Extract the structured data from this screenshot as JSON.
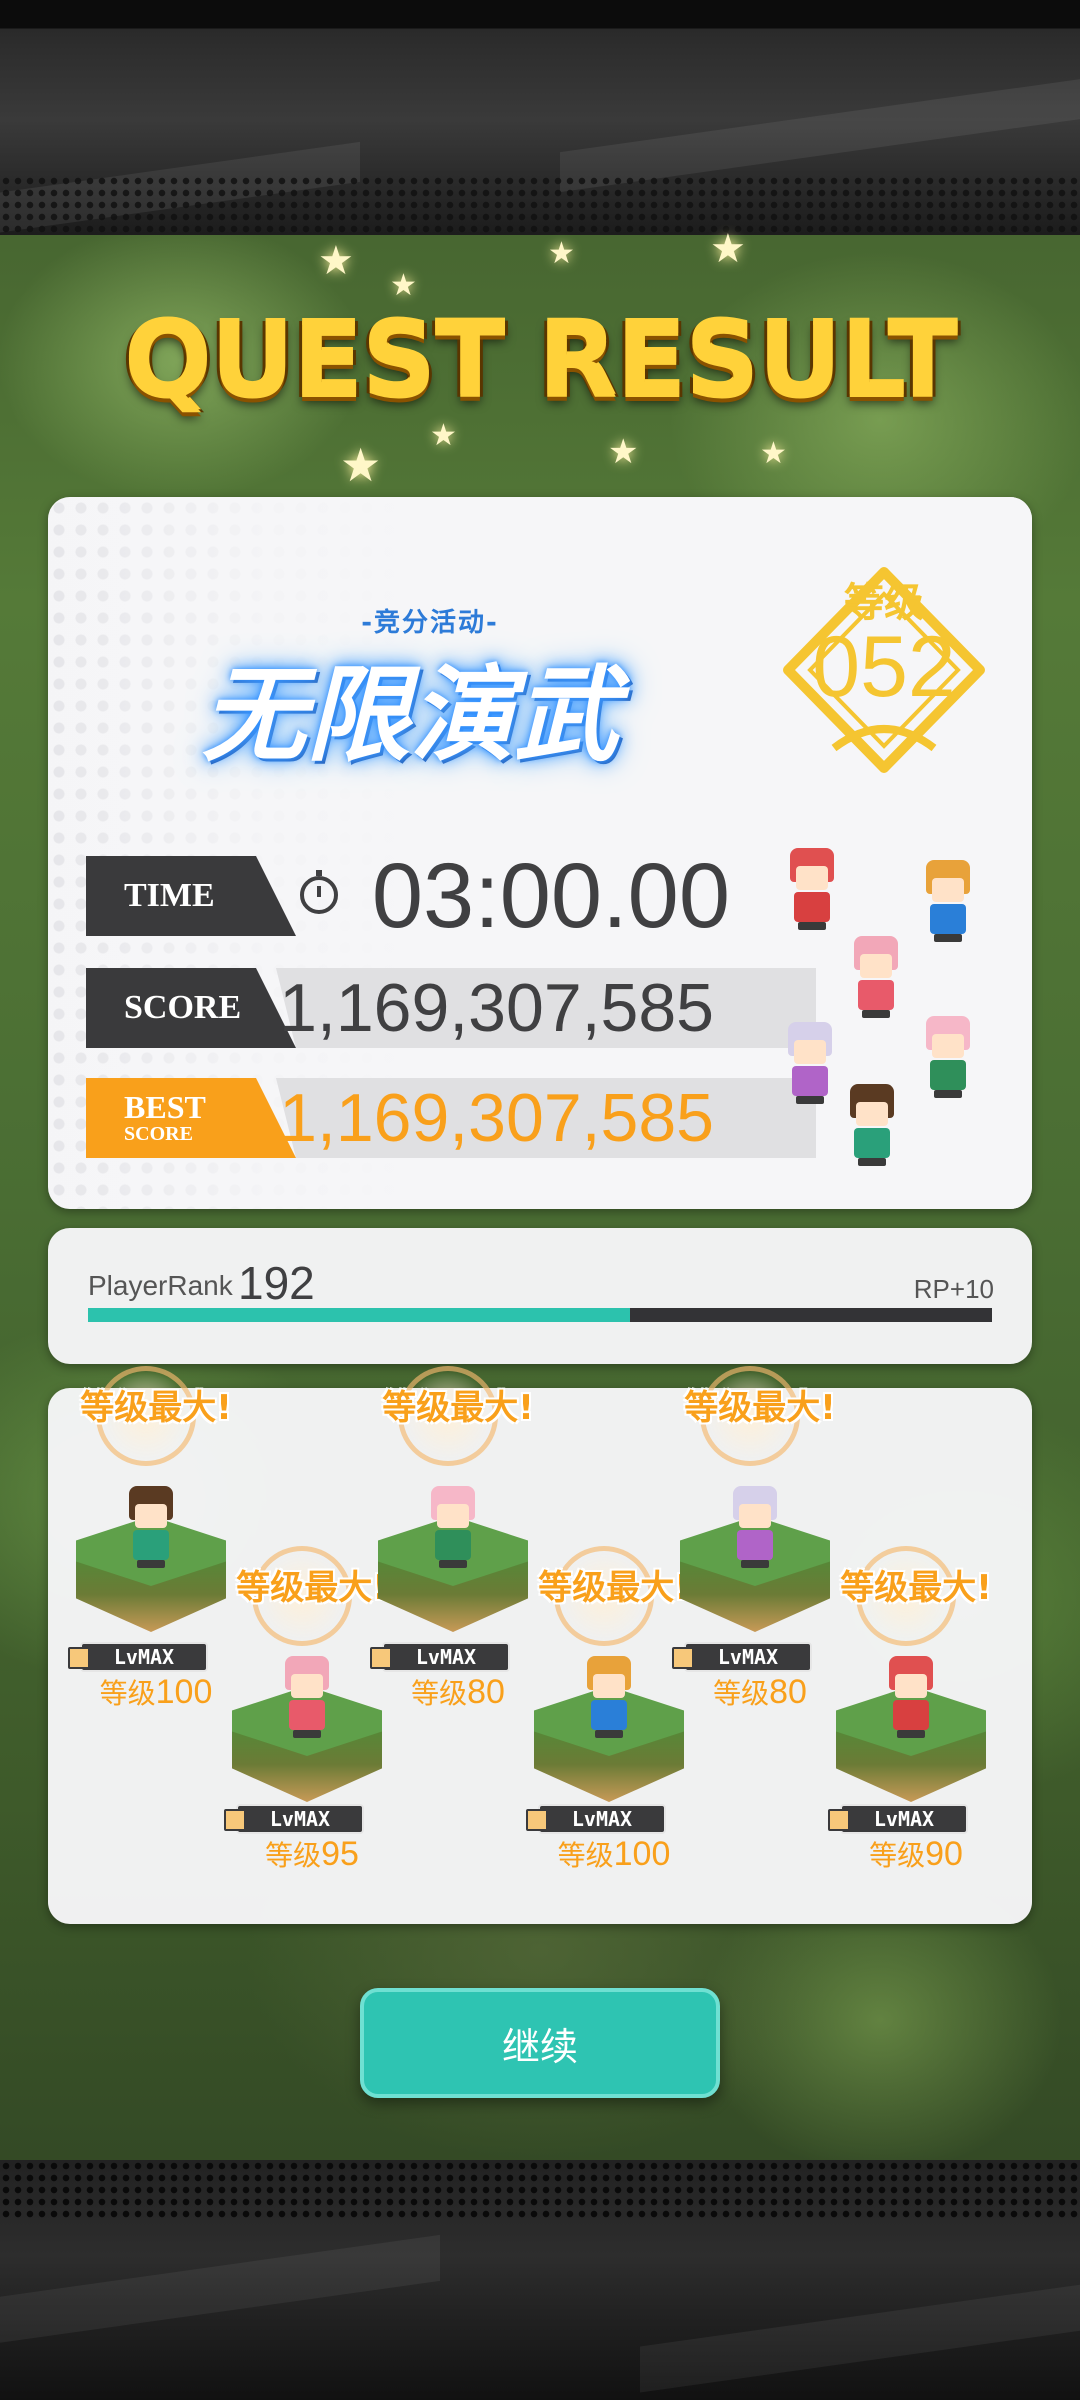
{
  "header": {
    "title": "QUEST RESULT"
  },
  "event": {
    "subtitle": "-竞分活动-",
    "title": "无限演武"
  },
  "rank_badge": {
    "label": "等级",
    "value": "052"
  },
  "stats": {
    "time_label": "TIME",
    "time_value": "03:00.00",
    "score_label": "SCORE",
    "score_value": "1,169,307,585",
    "best_label_top": "BEST",
    "best_label_bottom": "SCORE",
    "best_value": "1,169,307,585"
  },
  "player_rank": {
    "label": "PlayerRank",
    "value": "192",
    "rp_text": "RP+10",
    "progress": 0.6
  },
  "party": [
    {
      "lvmax_text": "等级最大!",
      "tag": "LvMAX",
      "level_prefix": "等级",
      "level": "100",
      "hair": "#5a3a22",
      "outfit": "#2aa07a"
    },
    {
      "lvmax_text": "等级最大!",
      "tag": "LvMAX",
      "level_prefix": "等级",
      "level": "95",
      "hair": "#f2a7b8",
      "outfit": "#e85a6a"
    },
    {
      "lvmax_text": "等级最大!",
      "tag": "LvMAX",
      "level_prefix": "等级",
      "level": "80",
      "hair": "#f6b7c8",
      "outfit": "#2f8f5a"
    },
    {
      "lvmax_text": "等级最大!",
      "tag": "LvMAX",
      "level_prefix": "等级",
      "level": "100",
      "hair": "#e8a23a",
      "outfit": "#2a7fd8"
    },
    {
      "lvmax_text": "等级最大!",
      "tag": "LvMAX",
      "level_prefix": "等级",
      "level": "80",
      "hair": "#d6d0ea",
      "outfit": "#b064c8"
    },
    {
      "lvmax_text": "等级最大!",
      "tag": "LvMAX",
      "level_prefix": "等级",
      "level": "90",
      "hair": "#e05050",
      "outfit": "#d84040"
    }
  ],
  "actions": {
    "continue_label": "继续"
  },
  "colors": {
    "accent_orange": "#f9a01b",
    "accent_teal": "#2ec4b2",
    "title_gold": "#ffd23a",
    "badge_yellow": "#f5c531"
  }
}
